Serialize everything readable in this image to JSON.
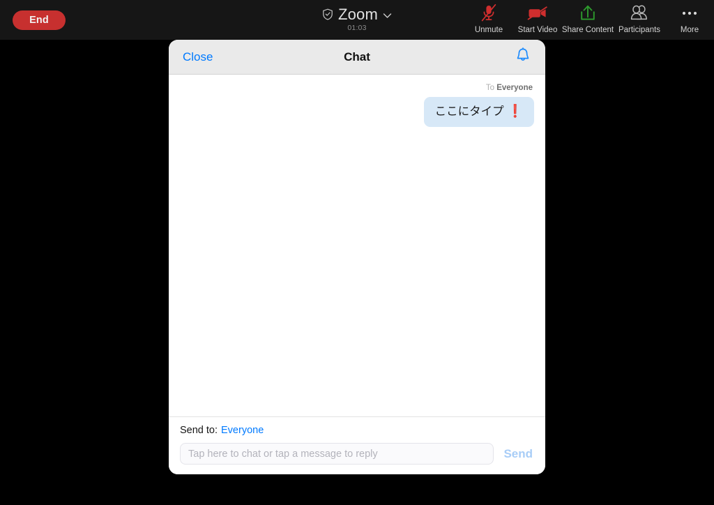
{
  "toolbar": {
    "end_label": "End",
    "meeting_title": "Zoom",
    "meeting_timer": "01:03",
    "shield_icon": "shield-check-icon",
    "chevron_icon": "chevron-down-icon",
    "actions": [
      {
        "label": "Unmute",
        "icon": "microphone-muted-icon",
        "color": "#cf2e2e"
      },
      {
        "label": "Start Video",
        "icon": "video-off-icon",
        "color": "#cf2e2e"
      },
      {
        "label": "Share Content",
        "icon": "share-upload-icon",
        "color": "#2d9b2d"
      },
      {
        "label": "Participants",
        "icon": "participants-icon",
        "color": "#b9b9b9"
      },
      {
        "label": "More",
        "icon": "more-dots-icon",
        "color": "#d8d8d8"
      }
    ]
  },
  "chat": {
    "close_label": "Close",
    "title": "Chat",
    "bell_icon": "bell-notification-icon",
    "messages": [
      {
        "to_word": "To",
        "to_target": "Everyone",
        "text": "ここにタイプ",
        "emoji": "❗"
      }
    ],
    "footer": {
      "send_to_label": "Send to:",
      "send_to_value": "Everyone",
      "input_value": "",
      "input_placeholder": "Tap here to chat or tap a message to reply",
      "send_label": "Send"
    }
  },
  "colors": {
    "end_red": "#c7302f",
    "accent_blue": "#007aff",
    "bubble_blue": "#d7e8f7",
    "send_disabled": "#a8cdf7",
    "toolbar_bg": "#161616",
    "header_gray": "#eaeaea"
  }
}
